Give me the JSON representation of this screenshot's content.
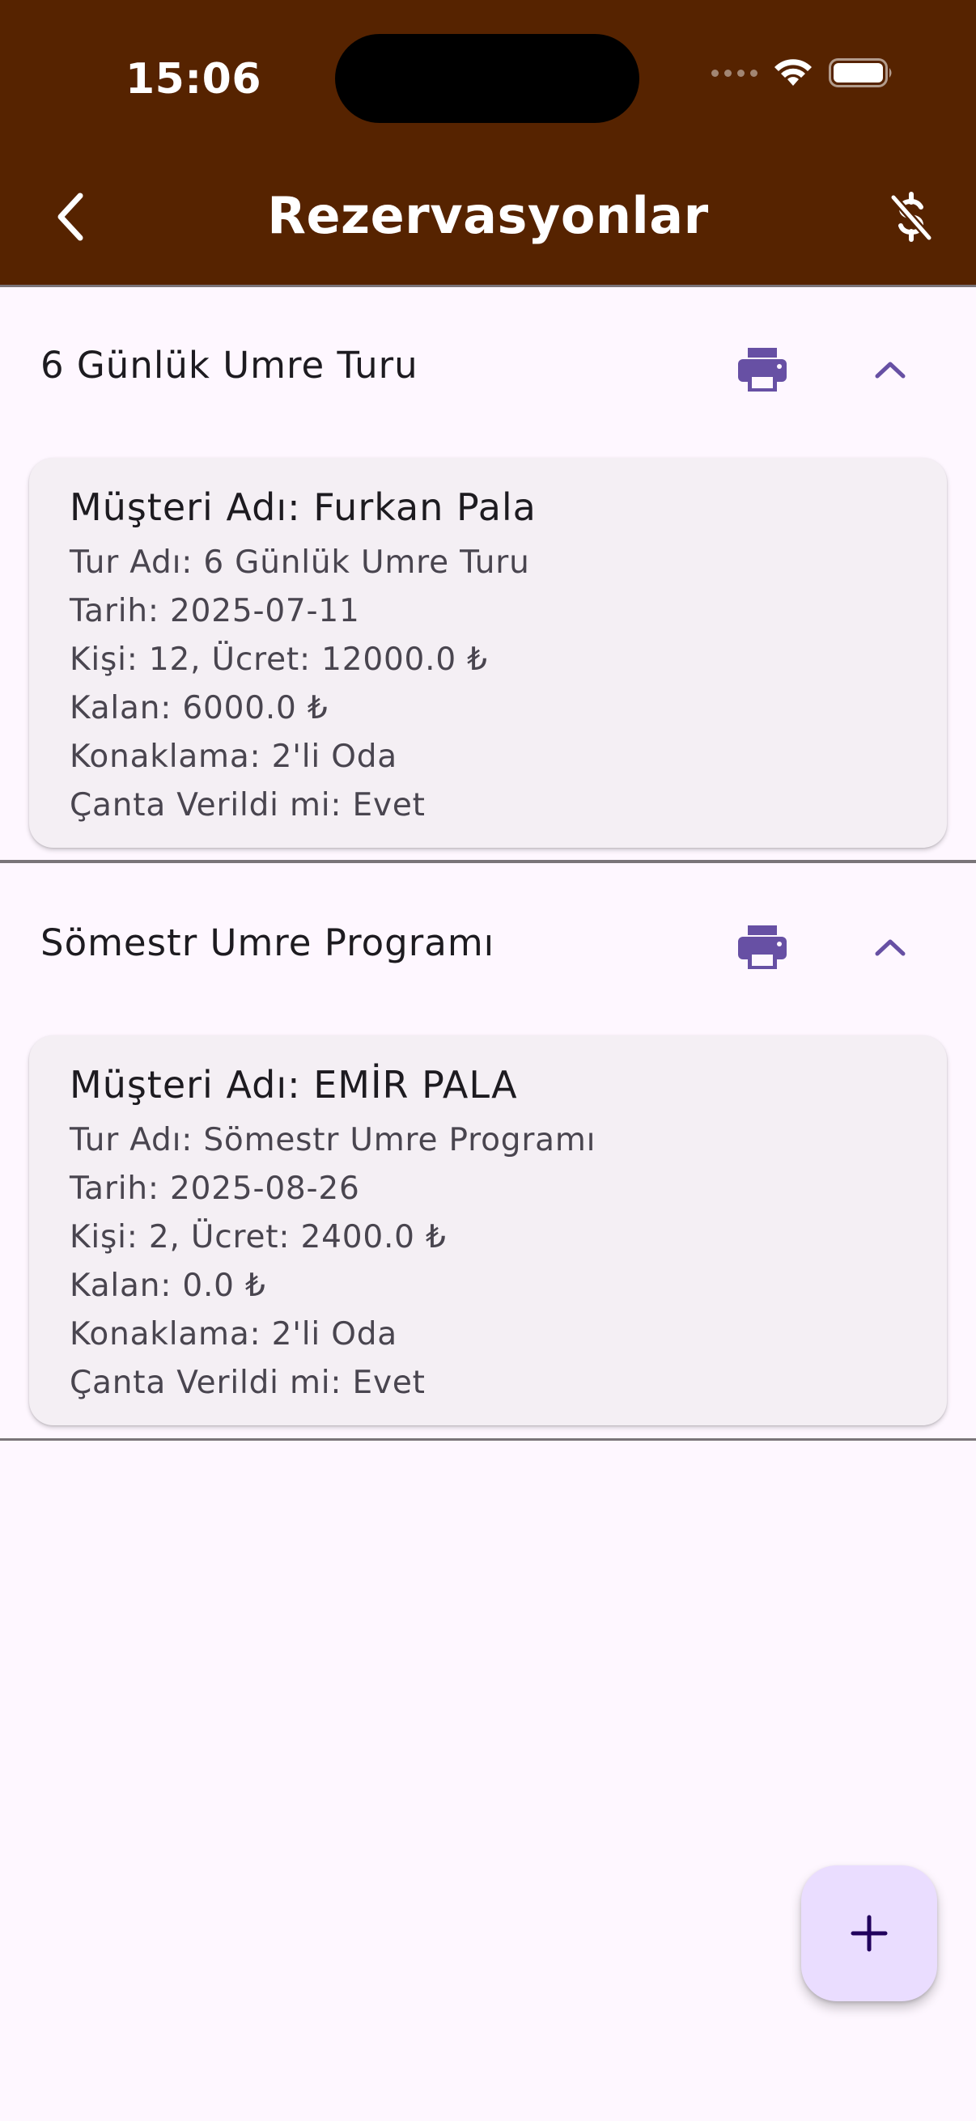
{
  "status_bar": {
    "time": "15:06"
  },
  "app_bar": {
    "title": "Rezervasyonlar",
    "back_icon": "chevron-left-icon",
    "action_icon": "money-off-icon",
    "background": "#562300"
  },
  "groups": [
    {
      "title": "6 Günlük Umre Turu",
      "reservations": [
        {
          "customer": "Müşteri Adı: Furkan Pala",
          "tour": "Tur Adı: 6 Günlük Umre Turu",
          "date": "Tarih: 2025-07-11",
          "people_price": "Kişi: 12, Ücret: 12000.0 ₺",
          "remaining": "Kalan: 6000.0 ₺",
          "accommodation": "Konaklama: 2'li Oda",
          "bag_given": "Çanta Verildi mi: Evet"
        }
      ]
    },
    {
      "title": "Sömestr Umre Programı",
      "reservations": [
        {
          "customer": "Müşteri Adı: EMİR PALA",
          "tour": "Tur Adı: Sömestr Umre Programı",
          "date": "Tarih: 2025-08-26",
          "people_price": "Kişi: 2, Ücret: 2400.0 ₺",
          "remaining": "Kalan: 0.0 ₺",
          "accommodation": "Konaklama: 2'li Oda",
          "bag_given": "Çanta Verildi mi: Evet"
        }
      ]
    }
  ],
  "fab": {
    "icon": "plus-icon"
  },
  "colors": {
    "accent": "#6750A4",
    "background": "#FEF7FF",
    "card": "#F4EFF4",
    "fab": "#EADDFF"
  }
}
